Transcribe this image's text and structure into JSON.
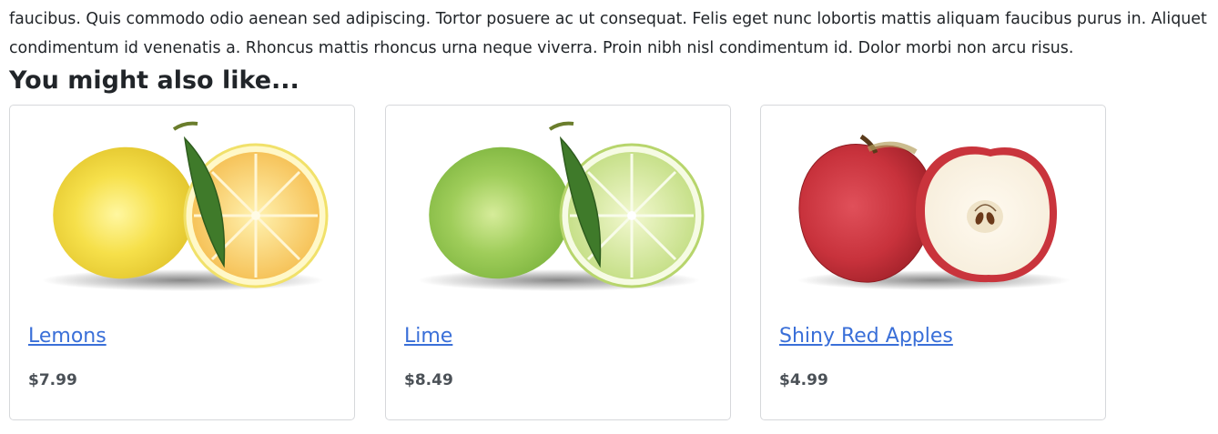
{
  "intro": {
    "line1": "faucibus. Quis commodo odio aenean sed adipiscing. Tortor posuere ac ut consequat. Felis eget nunc lobortis mattis aliquam faucibus purus in. Aliquet",
    "line2": "condimentum id venenatis a. Rhoncus mattis rhoncus urna neque viverra. Proin nibh nisl condimentum id. Dolor morbi non arcu risus."
  },
  "related": {
    "heading": "You might also like...",
    "products": [
      {
        "title": "Lemons",
        "price": "$7.99",
        "image": "lemon-illustration"
      },
      {
        "title": "Lime",
        "price": "$8.49",
        "image": "lime-illustration"
      },
      {
        "title": "Shiny Red Apples",
        "price": "$4.99",
        "image": "red-apple-illustration"
      }
    ]
  },
  "colors": {
    "link": "#3a6fd8",
    "text": "#212529",
    "price": "#4b5157",
    "card_border": "#d6d8db"
  }
}
